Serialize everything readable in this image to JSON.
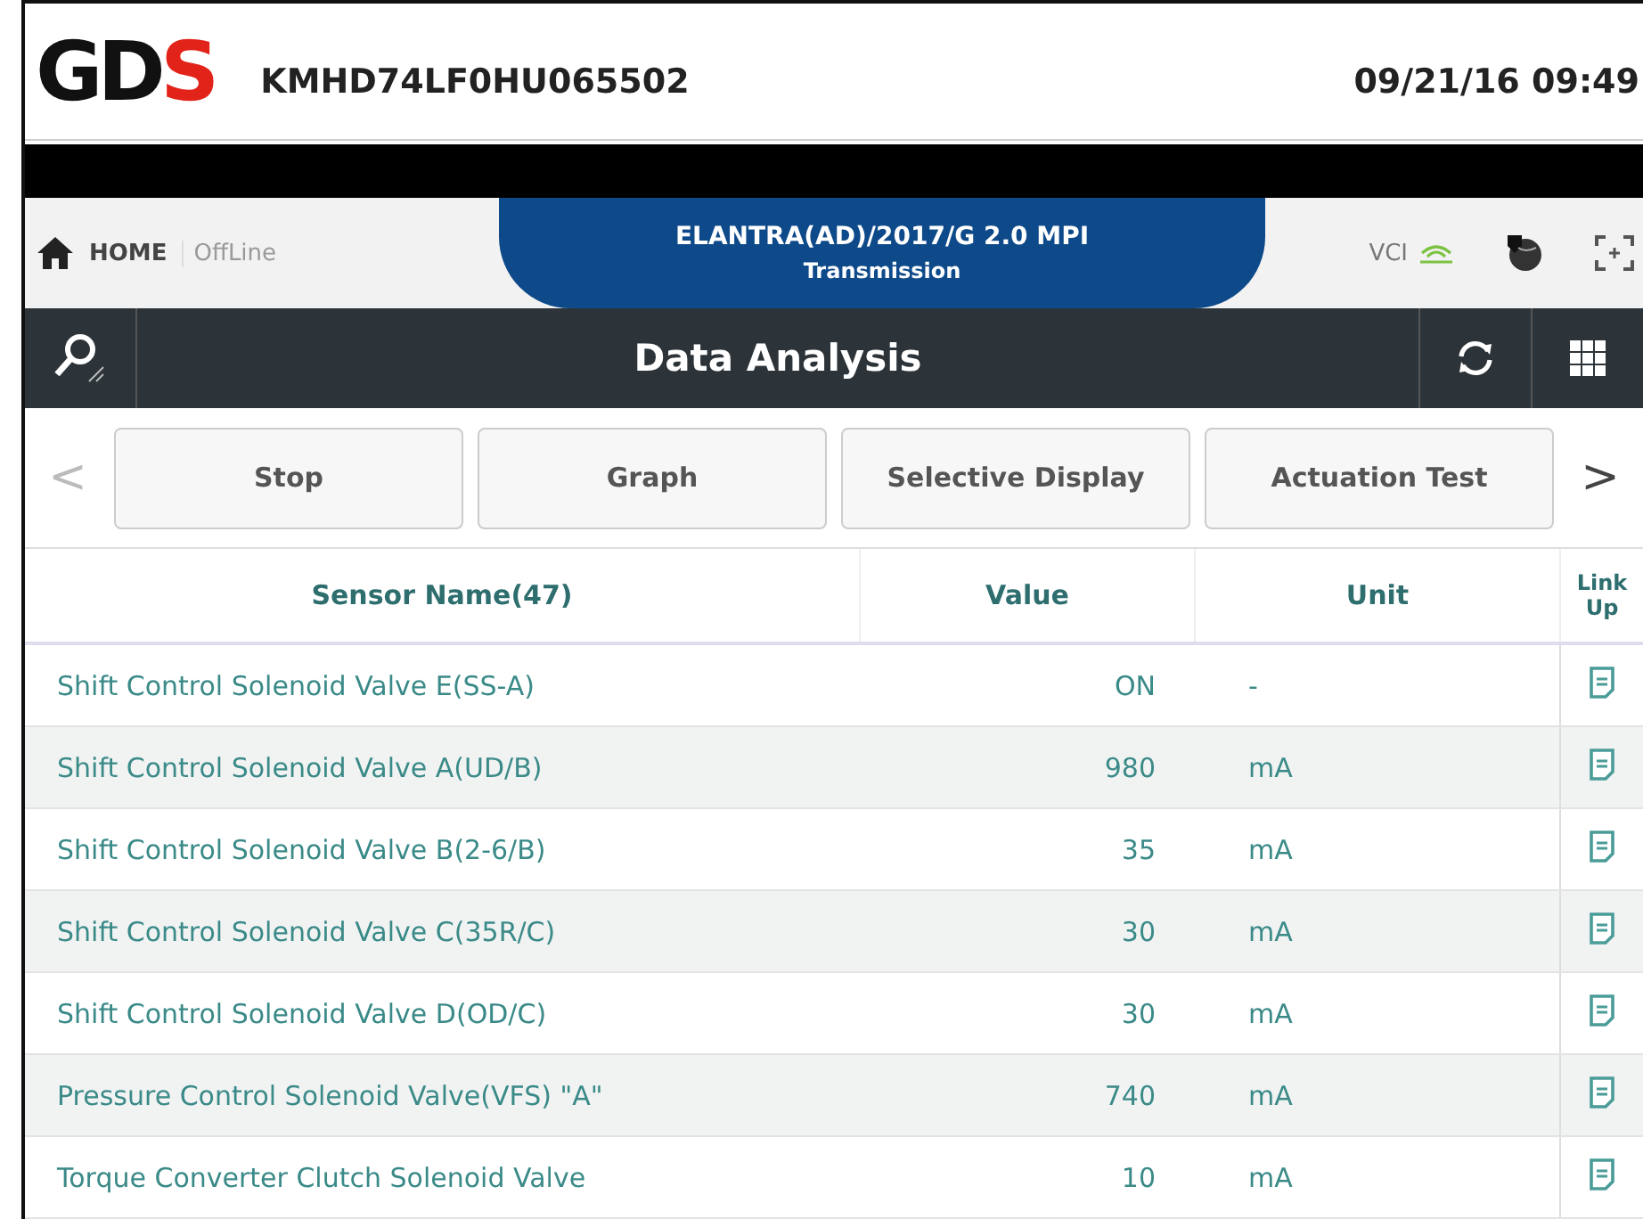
{
  "header": {
    "logo_main": "GD",
    "logo_accent": "S",
    "vin": "KMHD74LF0HU065502",
    "datetime": "09/21/16 09:49"
  },
  "nav": {
    "home": "HOME",
    "mode": "OffLine",
    "vehicle": "ELANTRA(AD)/2017/G 2.0 MPI",
    "system": "Transmission",
    "vci": "VCI"
  },
  "title_bar": {
    "title": "Data Analysis"
  },
  "toolbar": {
    "prev": "<",
    "next": ">",
    "buttons": [
      "Stop",
      "Graph",
      "Selective Display",
      "Actuation Test"
    ]
  },
  "table": {
    "columns": [
      "Sensor Name(47)",
      "Value",
      "Unit",
      "Link Up"
    ],
    "rows": [
      {
        "name": "Shift Control Solenoid Valve E(SS-A)",
        "value": "ON",
        "unit": "-"
      },
      {
        "name": "Shift Control Solenoid Valve A(UD/B)",
        "value": "980",
        "unit": "mA"
      },
      {
        "name": "Shift Control Solenoid Valve B(2-6/B)",
        "value": "35",
        "unit": "mA"
      },
      {
        "name": "Shift Control Solenoid Valve C(35R/C)",
        "value": "30",
        "unit": "mA"
      },
      {
        "name": "Shift Control Solenoid Valve D(OD/C)",
        "value": "30",
        "unit": "mA"
      },
      {
        "name": "Pressure Control Solenoid Valve(VFS) \"A\"",
        "value": "740",
        "unit": "mA"
      },
      {
        "name": "Torque Converter Clutch Solenoid Valve",
        "value": "10",
        "unit": "mA"
      }
    ]
  }
}
